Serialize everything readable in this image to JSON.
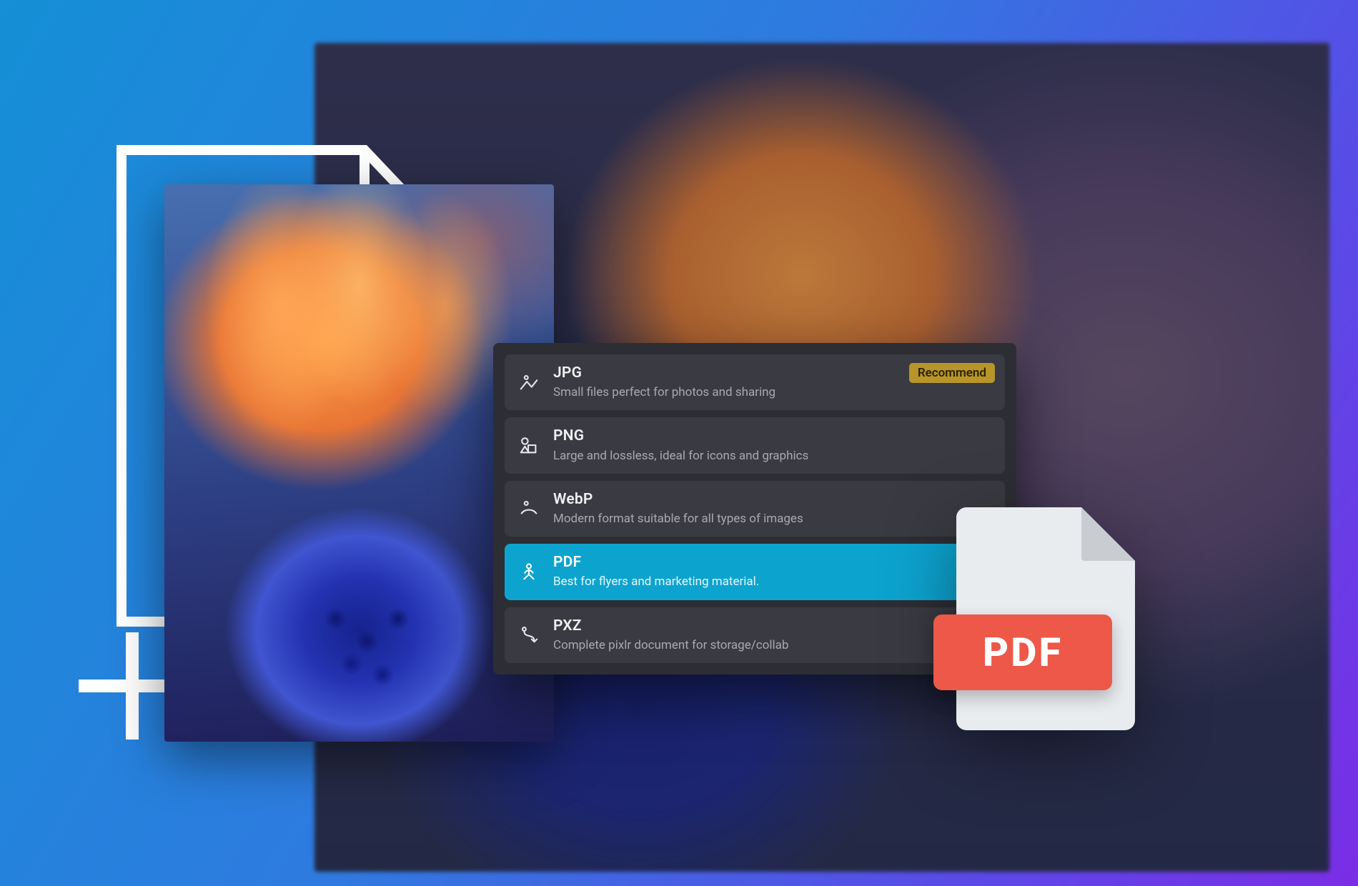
{
  "formats": [
    {
      "key": "jpg",
      "name": "JPG",
      "desc": "Small files perfect for photos and sharing",
      "icon": "image-icon",
      "selected": false,
      "badge": "Recommend"
    },
    {
      "key": "png",
      "name": "PNG",
      "desc": "Large and lossless, ideal for icons and graphics",
      "icon": "shapes-icon",
      "selected": false
    },
    {
      "key": "webp",
      "name": "WebP",
      "desc": "Modern format suitable for all types of images",
      "icon": "person-icon",
      "selected": false
    },
    {
      "key": "pdf",
      "name": "PDF",
      "desc": "Best for flyers and marketing material.",
      "icon": "pdf-icon",
      "selected": true
    },
    {
      "key": "pxz",
      "name": "PXZ",
      "desc": "Complete pixlr document for storage/collab",
      "icon": "route-icon",
      "selected": false
    }
  ],
  "pdf_badge_text": "PDF",
  "colors": {
    "panel_bg": "#2d2e34",
    "option_bg": "#3a3b42",
    "selected_bg": "#0da3cf",
    "recommend_bg": "#b7952b",
    "pdf_red": "#ed5848"
  }
}
